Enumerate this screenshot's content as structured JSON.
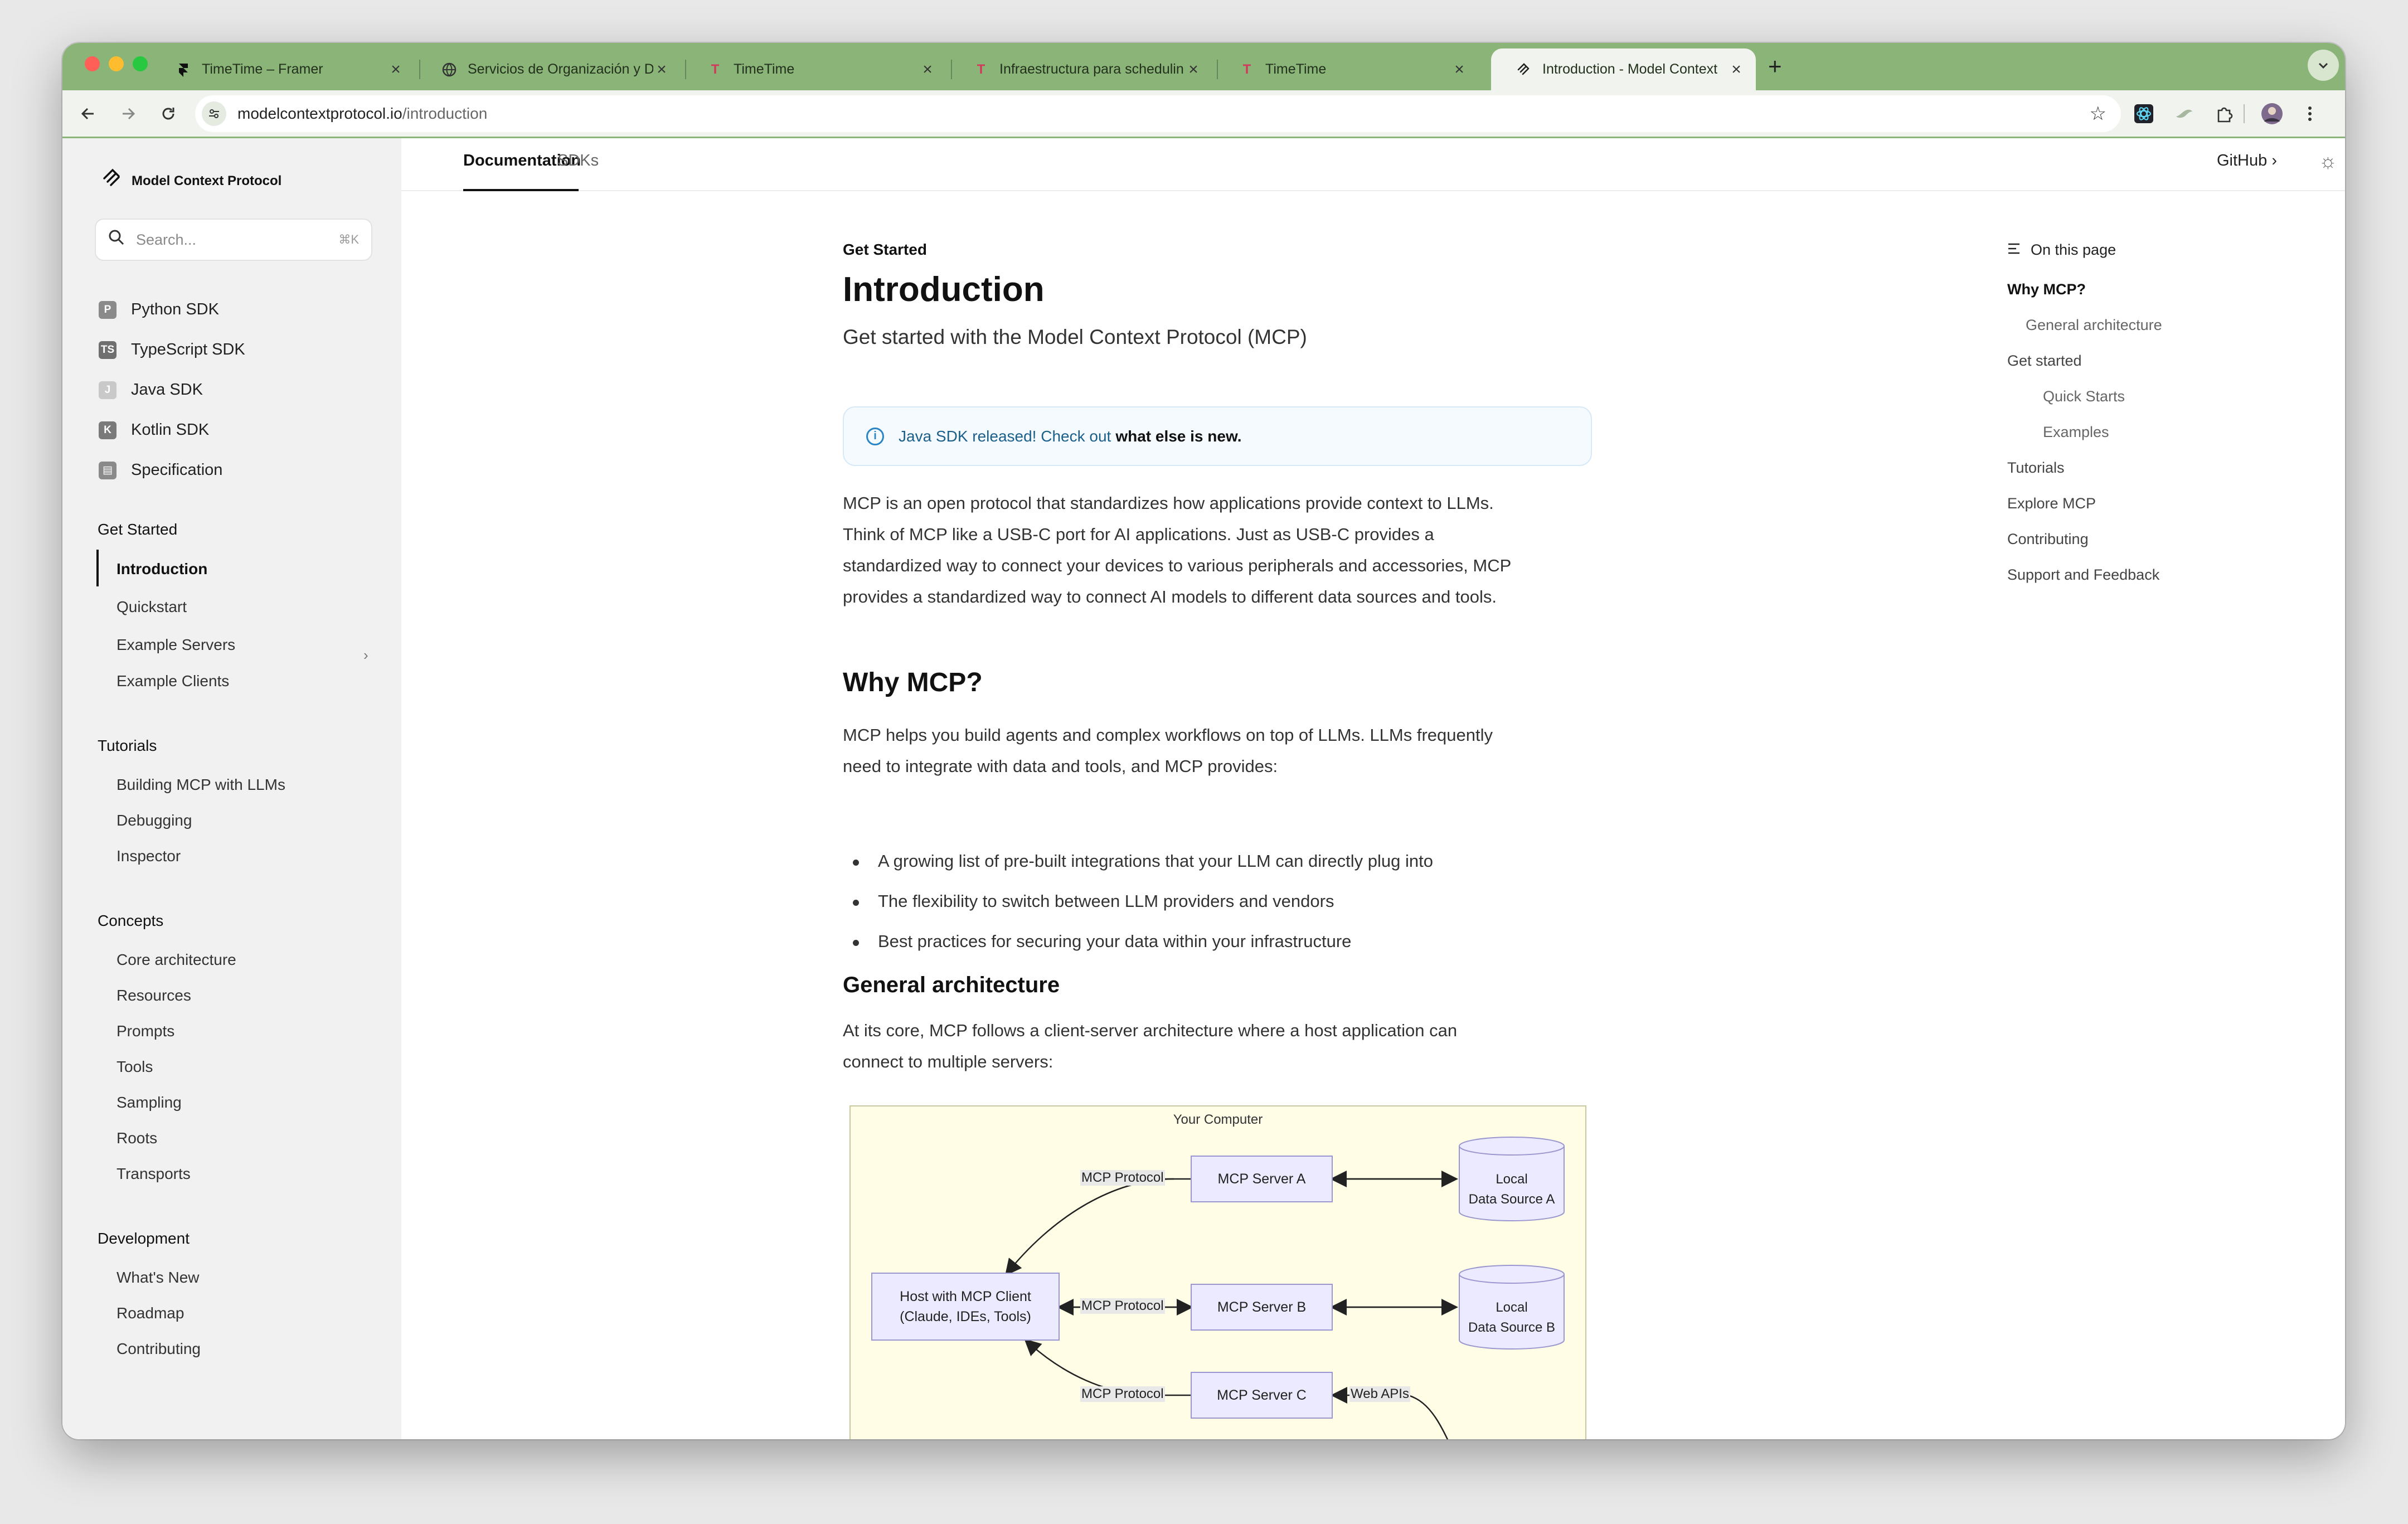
{
  "browser": {
    "tabs": [
      {
        "title": "TimeTime – Framer",
        "favicon": "framer-icon"
      },
      {
        "title": "Servicios de Organización y D",
        "favicon": "globe-icon"
      },
      {
        "title": "TimeTime",
        "favicon": "timetime-icon"
      },
      {
        "title": "Infraestructura para schedulin",
        "favicon": "timetime-icon"
      },
      {
        "title": "TimeTime",
        "favicon": "timetime-icon"
      },
      {
        "title": "Introduction - Model Context",
        "favicon": "mcp-icon"
      }
    ],
    "url_domain": "modelcontextprotocol.io",
    "url_path": "/introduction",
    "accent_color": "#8ab478"
  },
  "site": {
    "name": "Model Context Protocol",
    "search_placeholder": "Search...",
    "search_shortcut": "⌘K",
    "top_tabs": [
      "Documentation",
      "SDKs"
    ],
    "github_label": "GitHub"
  },
  "sidebar": {
    "sdks": [
      {
        "label": "Python SDK"
      },
      {
        "label": "TypeScript SDK"
      },
      {
        "label": "Java SDK"
      },
      {
        "label": "Kotlin SDK"
      },
      {
        "label": "Specification"
      }
    ],
    "groups": [
      {
        "title": "Get Started",
        "items": [
          "Introduction",
          "Quickstart",
          "Example Servers",
          "Example Clients"
        ]
      },
      {
        "title": "Tutorials",
        "items": [
          "Building MCP with LLMs",
          "Debugging",
          "Inspector"
        ]
      },
      {
        "title": "Concepts",
        "items": [
          "Core architecture",
          "Resources",
          "Prompts",
          "Tools",
          "Sampling",
          "Roots",
          "Transports"
        ]
      },
      {
        "title": "Development",
        "items": [
          "What's New",
          "Roadmap",
          "Contributing"
        ]
      }
    ]
  },
  "page": {
    "eyebrow": "Get Started",
    "title": "Introduction",
    "subtitle": "Get started with the Model Context Protocol (MCP)",
    "callout_text": "Java SDK released! Check out",
    "callout_link": "what else is new.",
    "intro": [
      "MCP is an open protocol that standardizes how applications provide context to LLMs.",
      "Think of MCP like a USB-C port for AI applications. Just as USB-C provides a",
      "standardized way to connect your devices to various peripherals and accessories, MCP",
      "provides a standardized way to connect AI models to different data sources and tools."
    ],
    "why_heading": "Why MCP?",
    "why_text": [
      "MCP helps you build agents and complex workflows on top of LLMs. LLMs frequently",
      "need to integrate with data and tools, and MCP provides:"
    ],
    "bullets": [
      "A growing list of pre-built integrations that your LLM can directly plug into",
      "The flexibility to switch between LLM providers and vendors",
      "Best practices for securing your data within your infrastructure"
    ],
    "arch_heading": "General architecture",
    "arch_text": [
      "At its core, MCP follows a client-server architecture where a host application can",
      "connect to multiple servers:"
    ]
  },
  "diagram": {
    "title": "Your Computer",
    "host": [
      "Host with MCP Client",
      "(Claude, IDEs, Tools)"
    ],
    "servers": [
      "MCP Server A",
      "MCP Server B",
      "MCP Server C"
    ],
    "protocol_label": "MCP Protocol",
    "web_label": "Web APIs",
    "sources": [
      [
        "Local",
        "Data Source A"
      ],
      [
        "Local",
        "Data Source B"
      ]
    ]
  },
  "toc": {
    "heading": "On this page",
    "items": [
      "Why MCP?",
      "General architecture",
      "Get started",
      "Quick Starts",
      "Examples",
      "Tutorials",
      "Explore MCP",
      "Contributing",
      "Support and Feedback"
    ]
  }
}
